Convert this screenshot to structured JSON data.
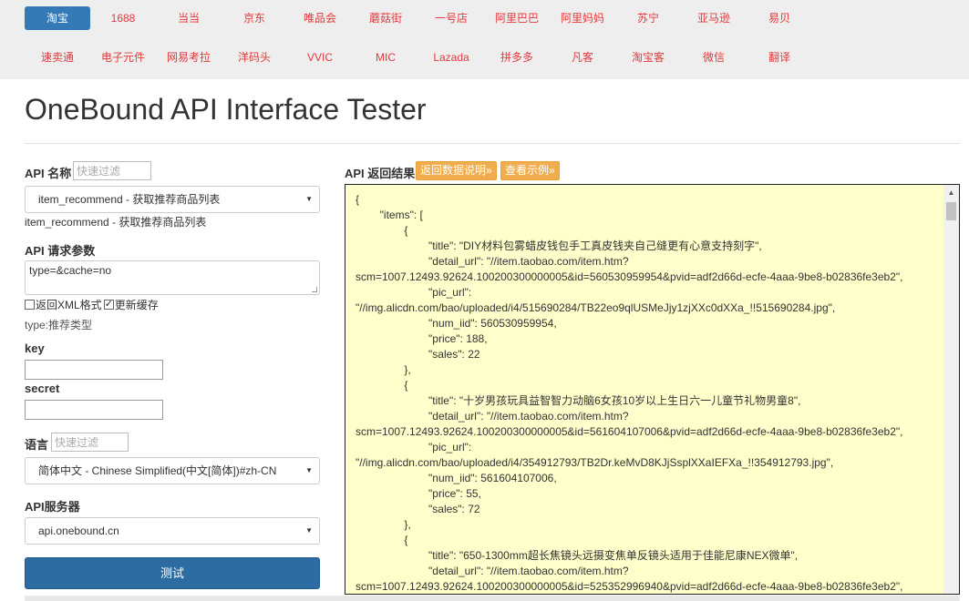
{
  "nav": {
    "row1": [
      "淘宝",
      "1688",
      "当当",
      "京东",
      "唯品会",
      "蘑菇街",
      "一号店",
      "阿里巴巴",
      "阿里妈妈",
      "苏宁",
      "亚马逊",
      "易贝"
    ],
    "row2": [
      "速卖通",
      "电子元件",
      "网易考拉",
      "洋码头",
      "VVIC",
      "MIC",
      "Lazada",
      "拼多多",
      "凡客",
      "淘宝客",
      "微信",
      "翻译"
    ],
    "active": "淘宝"
  },
  "page_title": "OneBound API Interface Tester",
  "form": {
    "api_name_label": "API 名称",
    "filter_placeholder": "快速过滤",
    "api_selected": "item_recommend - 获取推荐商品列表",
    "api_desc": "item_recommend - 获取推荐商品列表",
    "params_label": "API 请求参数",
    "params_value": "type=&cache=no",
    "xml_label": "返回XML格式",
    "xml_checked": false,
    "cache_label": "更新缓存",
    "cache_checked": true,
    "param_hint": "type:推荐类型",
    "key_label": "key",
    "secret_label": "secret",
    "lang_label": "语言",
    "lang_selected": "简体中文 - Chinese Simplified(中文[简体])#zh-CN",
    "server_label": "API服务器",
    "server_selected": "api.onebound.cn",
    "test_button": "测试"
  },
  "result": {
    "label": "API 返回结果",
    "btn_doc": "返回数据说明»",
    "btn_example": "查看示例»",
    "body": "{\n        \"items\": [\n                {\n                        \"title\": \"DIY材料包雾蜡皮钱包手工真皮钱夹自己缝更有心意支持刻字\",\n                        \"detail_url\": \"//item.taobao.com/item.htm?\nscm=1007.12493.92624.100200300000005&id=560530959954&pvid=adf2d66d-ecfe-4aaa-9be8-b02836fe3eb2\",\n                        \"pic_url\":\n\"//img.alicdn.com/bao/uploaded/i4/515690284/TB22eo9qlUSMeJjy1zjXXc0dXXa_!!515690284.jpg\",\n                        \"num_iid\": 560530959954,\n                        \"price\": 188,\n                        \"sales\": 22\n                },\n                {\n                        \"title\": \"十岁男孩玩具益智智力动脑6女孩10岁以上生日六一儿童节礼物男童8\",\n                        \"detail_url\": \"//item.taobao.com/item.htm?\nscm=1007.12493.92624.100200300000005&id=561604107006&pvid=adf2d66d-ecfe-4aaa-9be8-b02836fe3eb2\",\n                        \"pic_url\":\n\"//img.alicdn.com/bao/uploaded/i4/354912793/TB2Dr.keMvD8KJjSsplXXaIEFXa_!!354912793.jpg\",\n                        \"num_iid\": 561604107006,\n                        \"price\": 55,\n                        \"sales\": 72\n                },\n                {\n                        \"title\": \"650-1300mm超长焦镜头远摄变焦单反镜头适用于佳能尼康NEX微单\",\n                        \"detail_url\": \"//item.taobao.com/item.htm?\nscm=1007.12493.92624.100200300000005&id=525352996940&pvid=adf2d66d-ecfe-4aaa-9be8-b02836fe3eb2\","
  },
  "colors": {
    "nav_bg": "#eeeeee",
    "nav_link": "#e4393c",
    "active_tab": "#337ab7",
    "primary_button": "#2d6ca2",
    "orange_button": "#f0ad4e",
    "result_bg": "#ffffcc"
  },
  "icons": [
    "caret-down-icon",
    "checkbox-icon",
    "scroll-up-arrow-icon"
  ]
}
